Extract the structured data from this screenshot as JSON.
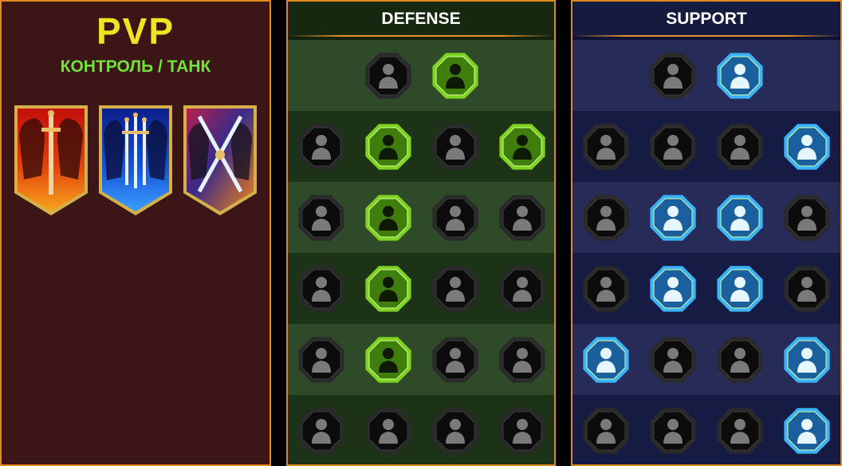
{
  "left": {
    "title": "PVP",
    "subtitle": "КОНТРОЛЬ / ТАНК",
    "banners": [
      "offense-banner-icon",
      "defense-banner-icon",
      "support-banner-icon"
    ]
  },
  "defense": {
    "title": "DEFENSE",
    "colors": {
      "active": "#7ed321",
      "active_fill": "#3f7d0c"
    },
    "rows": [
      [
        {
          "icon": "bricks-icon",
          "active": false
        },
        {
          "icon": "fist-icon",
          "active": true
        }
      ],
      [
        {
          "icon": "shield-chevron-icon",
          "active": false
        },
        {
          "icon": "heart-shield-icon",
          "active": true
        },
        {
          "icon": "stone-golem-icon",
          "active": false
        },
        {
          "icon": "crossed-blades-icon",
          "active": true
        }
      ],
      [
        {
          "icon": "fighter-icon",
          "active": false
        },
        {
          "icon": "knight-shield-icon",
          "active": true
        },
        {
          "icon": "heart-skull-icon",
          "active": false
        },
        {
          "icon": "hooded-figure-icon",
          "active": false
        }
      ],
      [
        {
          "icon": "crowd-icon",
          "active": false
        },
        {
          "icon": "hourglass-icon",
          "active": true
        },
        {
          "icon": "hand-icon",
          "active": false
        },
        {
          "icon": "bull-skull-icon",
          "active": false
        }
      ],
      [
        {
          "icon": "dash-runner-icon",
          "active": false
        },
        {
          "icon": "claw-marks-icon",
          "active": true
        },
        {
          "icon": "sun-skull-icon",
          "active": false
        },
        {
          "icon": "grab-hand-icon",
          "active": false
        }
      ],
      [
        {
          "icon": "flame-warrior-icon",
          "active": false
        },
        {
          "icon": "winged-shield-icon",
          "active": false
        },
        {
          "icon": "bearded-warrior-icon",
          "active": false
        },
        {
          "icon": "muscle-man-icon",
          "active": false
        }
      ]
    ]
  },
  "support": {
    "title": "SUPPORT",
    "colors": {
      "active": "#3ab4ff",
      "active_fill": "#1a5f9e"
    },
    "rows": [
      [
        {
          "icon": "heart-plus-icon",
          "active": false
        },
        {
          "icon": "speed-orbit-icon",
          "active": true
        }
      ],
      [
        {
          "icon": "praying-hands-icon",
          "active": false
        },
        {
          "icon": "shield-aura-icon",
          "active": false
        },
        {
          "icon": "smoke-skull-icon",
          "active": false
        },
        {
          "icon": "ice-blade-icon",
          "active": true
        }
      ],
      [
        {
          "icon": "buff-figure-icon",
          "active": false
        },
        {
          "icon": "lightning-icon",
          "active": true
        },
        {
          "icon": "cracked-lightning-icon",
          "active": true
        },
        {
          "icon": "twin-figures-icon",
          "active": false
        }
      ],
      [
        {
          "icon": "chain-heart-icon",
          "active": false
        },
        {
          "icon": "fireball-icon",
          "active": true
        },
        {
          "icon": "open-book-icon",
          "active": true
        },
        {
          "icon": "fierce-eyes-icon",
          "active": false
        }
      ],
      [
        {
          "icon": "compass-star-icon",
          "active": true
        },
        {
          "icon": "boot-icon",
          "active": false
        },
        {
          "icon": "eye-icon",
          "active": false
        },
        {
          "icon": "arrow-pierce-icon",
          "active": true
        }
      ],
      [
        {
          "icon": "potion-icon",
          "active": false
        },
        {
          "icon": "winged-skull-icon",
          "active": false
        },
        {
          "icon": "fist-cave-icon",
          "active": false
        },
        {
          "icon": "eagle-icon",
          "active": true
        }
      ]
    ]
  }
}
